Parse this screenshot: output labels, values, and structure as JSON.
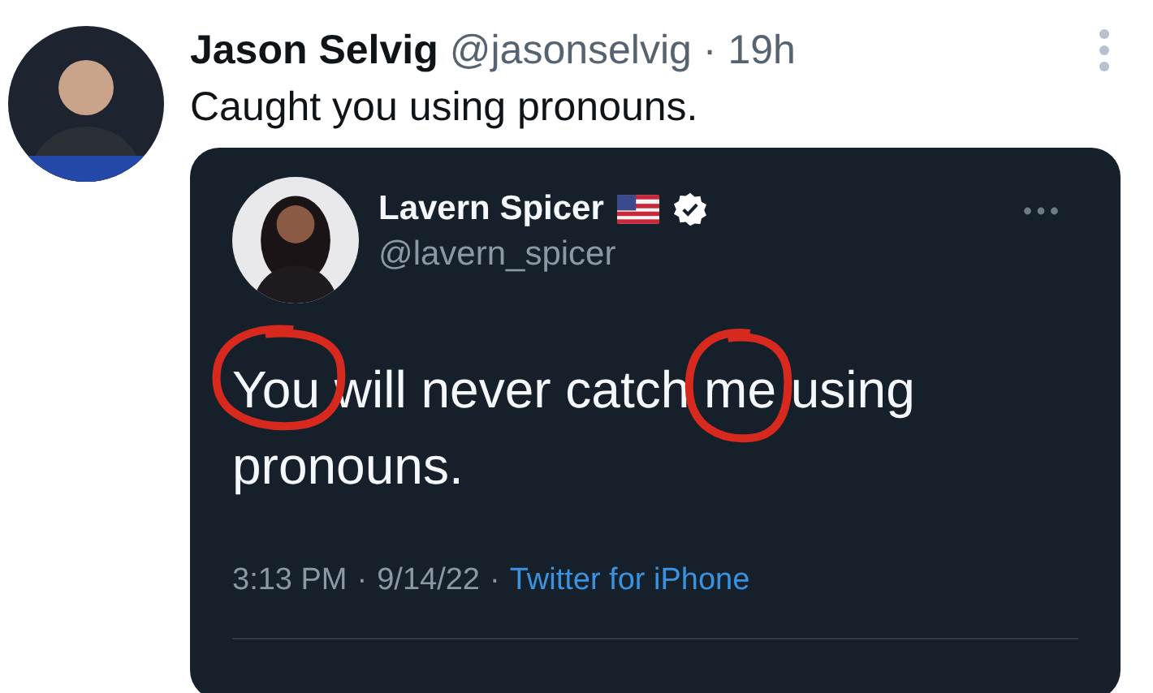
{
  "tweet": {
    "author_name": "Jason Selvig",
    "handle": "@jasonselvig",
    "separator": "·",
    "time": "19h",
    "text": "Caught you using pronouns.",
    "quoted": {
      "author_name": "Lavern Spicer",
      "handle": "@lavern_spicer",
      "verified": true,
      "text": "You will never catch me using pronouns.",
      "time": "3:13 PM",
      "separator_1": "·",
      "date": "9/14/22",
      "separator_2": "·",
      "source": "Twitter for iPhone",
      "annotations": [
        {
          "kind": "circle",
          "color": "#d8291e"
        },
        {
          "kind": "circle",
          "color": "#d8291e"
        }
      ]
    }
  }
}
